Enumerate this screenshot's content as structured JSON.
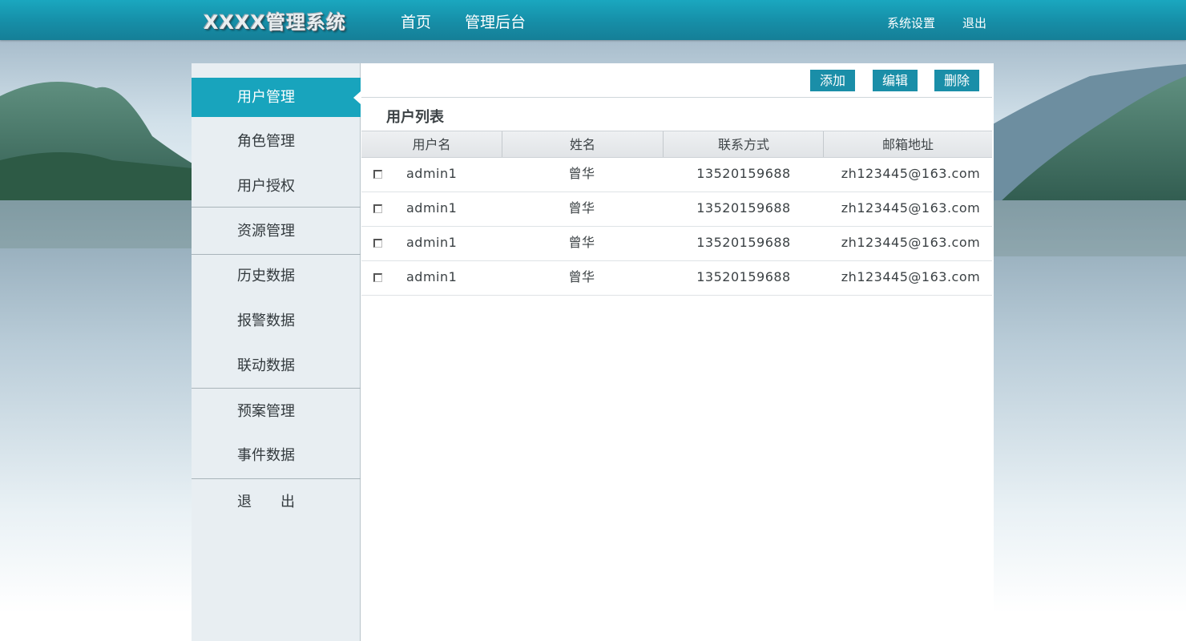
{
  "header": {
    "app_title": "XXXX管理系统",
    "nav": [
      "首页",
      "管理后台"
    ],
    "right_links": [
      "系统设置",
      "退出"
    ]
  },
  "sidebar": {
    "items": [
      {
        "label": "用户管理",
        "active": true
      },
      {
        "label": "角色管理"
      },
      {
        "label": "用户授权"
      },
      {
        "label": "资源管理"
      },
      {
        "label": "历史数据"
      },
      {
        "label": "报警数据"
      },
      {
        "label": "联动数据"
      },
      {
        "label": "预案管理"
      },
      {
        "label": "事件数据"
      },
      {
        "label": "退　　出"
      }
    ]
  },
  "toolbar": {
    "add_label": "添加",
    "edit_label": "编辑",
    "delete_label": "删除"
  },
  "user_list": {
    "title": "用户列表",
    "columns": [
      "用户名",
      "姓名",
      "联系方式",
      "邮箱地址"
    ],
    "rows": [
      {
        "username": "admin1",
        "name": "曾华",
        "phone": "13520159688",
        "email": "zh123445@163.com"
      },
      {
        "username": "admin1",
        "name": "曾华",
        "phone": "13520159688",
        "email": "zh123445@163.com"
      },
      {
        "username": "admin1",
        "name": "曾华",
        "phone": "13520159688",
        "email": "zh123445@163.com"
      },
      {
        "username": "admin1",
        "name": "曾华",
        "phone": "13520159688",
        "email": "zh123445@163.com"
      }
    ]
  },
  "colors": {
    "topbar": "#168ea7",
    "accent": "#18a4bd",
    "button": "#1a8ea8",
    "sidebar_bg": "#e8eef2"
  }
}
